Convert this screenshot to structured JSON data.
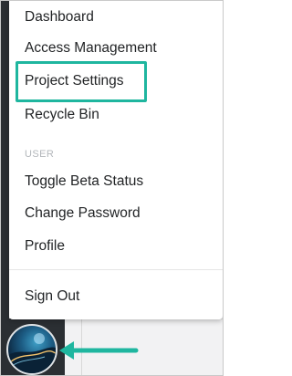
{
  "menu": {
    "items_top": [
      {
        "label": "Dashboard"
      },
      {
        "label": "Access Management"
      },
      {
        "label": "Project Settings"
      },
      {
        "label": "Recycle Bin"
      }
    ],
    "section_label": "USER",
    "items_user": [
      {
        "label": "Toggle Beta Status"
      },
      {
        "label": "Change Password"
      },
      {
        "label": "Profile"
      }
    ],
    "sign_out": "Sign Out"
  },
  "colors": {
    "highlight": "#1fb69f",
    "arrow": "#1fb69f",
    "rail": "#2b2f33"
  },
  "icons": {
    "avatar": "user-avatar-image",
    "arrow": "arrow-left-icon"
  }
}
